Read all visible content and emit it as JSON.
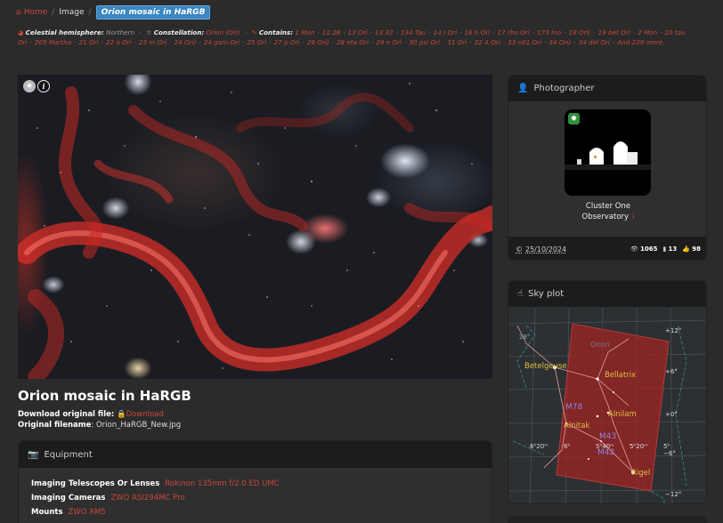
{
  "breadcrumb": {
    "home": "Home",
    "image": "Image",
    "current": "Orion mosaic in HaRGB"
  },
  "meta": {
    "hemisphere_label": "Celestial hemisphere:",
    "hemisphere_value": "Northern",
    "constellation_label": "Constellation:",
    "constellation_value": "Orion (Ori)",
    "contains_label": "Contains:",
    "objects": [
      "1 Mon",
      "11.28",
      "13 Ori",
      "13.32",
      "134 Tau",
      "14 i Ori",
      "16 h Ori",
      "17 rho Ori",
      "173 Ino",
      "19 Ori)",
      "19 bet Ori",
      "2 Mon",
      "20 tau Ori",
      "205 Martha",
      "21 Ori",
      "22 o Ori",
      "23 m Ori",
      "24 Ori)",
      "24 gam Ori",
      "25 Ori",
      "27 p Ori",
      "28 Ori)",
      "28 eta Ori",
      "29 e Ori",
      "30 psi Ori",
      "31 Ori",
      "32 A Ori",
      "33 n01 Ori",
      "34 Ori)",
      "34 del Ori",
      "And 239 more."
    ]
  },
  "image": {
    "title": "Orion mosaic in HaRGB"
  },
  "download": {
    "label": "Download original file:",
    "link": "Download"
  },
  "filename": {
    "label": "Original filename",
    "value": "Orion_HaRGB_New.jpg"
  },
  "equipment": {
    "header": "Equipment",
    "rows": [
      {
        "label": "Imaging Telescopes Or Lenses",
        "value": "Rokinon 135mm f/2.0 ED UMC"
      },
      {
        "label": "Imaging Cameras",
        "value": "ZWO ASI294MC Pro"
      },
      {
        "label": "Mounts",
        "value": "ZWO AM5"
      }
    ]
  },
  "photographer": {
    "header": "Photographer",
    "name_line1": "Cluster One",
    "name_line2": "Observatory",
    "info": "i",
    "date": "25/10/2024",
    "views": "1065",
    "bookmarks": "13",
    "likes": "98"
  },
  "skyplot": {
    "header": "Sky plot",
    "labels": {
      "betelgeuse": "Betelgeuse",
      "bellatrix": "Bellatrix",
      "alnilam": "Alnilam",
      "alnitak": "Alnitak",
      "m78": "M78",
      "m43": "M43",
      "m42": "M42",
      "rigel": "Rigel",
      "orion": "Orion"
    },
    "ra_ticks": [
      "6ʰ20ᵐ",
      "6ʰ",
      "5ʰ40ᵐ",
      "5ʰ20ᵐ",
      "5ʰ"
    ],
    "dec_ticks": [
      "+12°",
      "+6°",
      "+0°",
      "−6°",
      "−12°"
    ],
    "left_ticks": [
      "28°"
    ]
  }
}
